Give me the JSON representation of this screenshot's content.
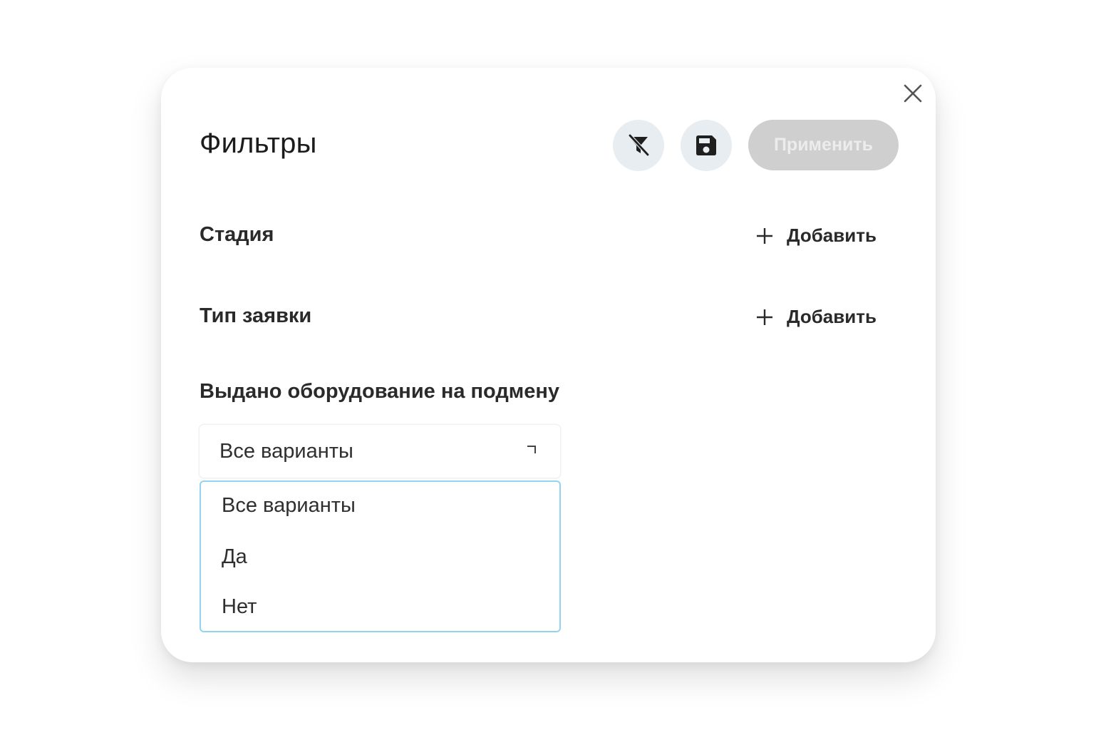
{
  "dialog": {
    "title": "Фильтры",
    "apply_label": "Применить",
    "clear_filters_icon": "filter-clear-icon",
    "save_icon": "floppy-disk-icon",
    "close_icon": "close-icon"
  },
  "filters": [
    {
      "label": "Стадия",
      "action_label": "Добавить",
      "action_icon": "plus-icon"
    },
    {
      "label": "Тип заявки",
      "action_label": "Добавить",
      "action_icon": "plus-icon"
    }
  ],
  "replacement_filter": {
    "label": "Выдано оборудование на подмену",
    "selected": "Все варианты",
    "options": [
      "Все варианты",
      "Да",
      "Нет"
    ],
    "dropdown_open": true,
    "dropdown_border_color": "#93d3f0"
  },
  "colors": {
    "icon_button_bg": "#e8edf1",
    "apply_button_bg_disabled": "#cfcfcf",
    "apply_button_text_disabled": "#ececec"
  }
}
